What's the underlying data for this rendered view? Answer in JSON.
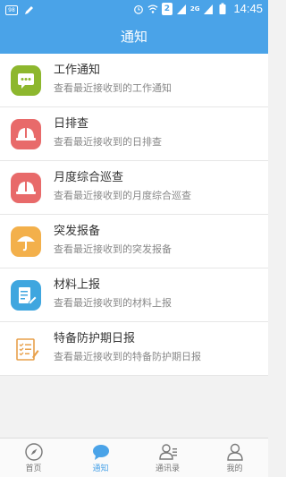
{
  "status_bar": {
    "badge": "98",
    "time": "14:45",
    "network": "2G",
    "sim": "2"
  },
  "title": "通知",
  "items": [
    {
      "title": "工作通知",
      "subtitle": "查看最近接收到的工作通知",
      "icon": "message-icon",
      "color": "#8db72e"
    },
    {
      "title": "日排查",
      "subtitle": "查看最近接收到的日排查",
      "icon": "helmet-icon",
      "color": "#e86a6a"
    },
    {
      "title": "月度综合巡查",
      "subtitle": "查看最近接收到的月度综合巡查",
      "icon": "helmet-icon",
      "color": "#e86a6a"
    },
    {
      "title": "突发报备",
      "subtitle": "查看最近接收到的突发报备",
      "icon": "umbrella-icon",
      "color": "#f3b04b"
    },
    {
      "title": "材料上报",
      "subtitle": "查看最近接收到的材料上报",
      "icon": "document-edit-icon",
      "color": "#3fa6df"
    },
    {
      "title": "特备防护期日报",
      "subtitle": "查看最近接收到的特备防护期日报",
      "icon": "checklist-icon",
      "color": "#f3b04b"
    }
  ],
  "tabs": [
    {
      "label": "首页",
      "icon": "compass-icon"
    },
    {
      "label": "通知",
      "icon": "chat-bubble-icon"
    },
    {
      "label": "通讯录",
      "icon": "contacts-icon"
    },
    {
      "label": "我的",
      "icon": "user-icon"
    }
  ],
  "accent_color": "#4aa3e8"
}
